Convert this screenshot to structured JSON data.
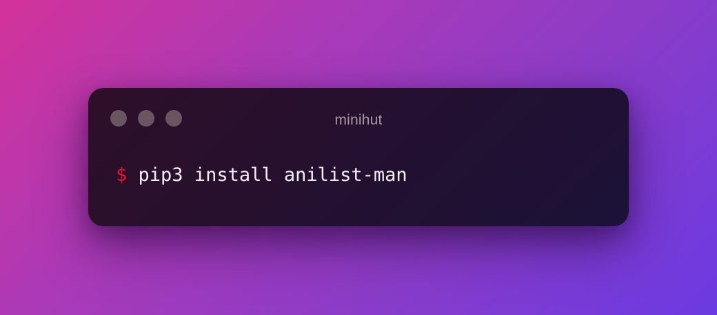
{
  "terminal": {
    "title": "minihut",
    "prompt": "$",
    "command": "pip3 install anilist-man"
  },
  "colors": {
    "background_start": "#d3339a",
    "background_end": "#6b3ae2",
    "window_bg": "#25102f",
    "prompt_color": "#e8142a",
    "command_color": "#f4eef2",
    "title_color": "#a898a4",
    "dot_color": "#6a5561"
  }
}
